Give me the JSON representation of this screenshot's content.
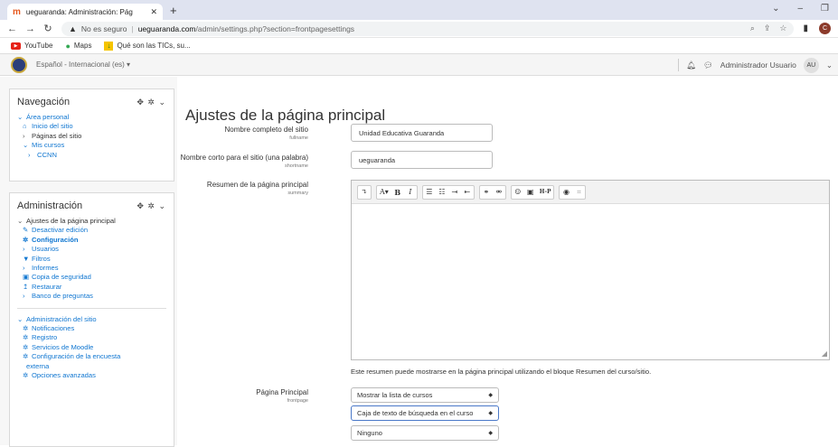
{
  "browser": {
    "tab_title": "ueguaranda: Administración: Pág",
    "url_secure_label": "No es seguro",
    "url_host": "ueguaranda.com",
    "url_path": "/admin/settings.php?section=frontpagesettings",
    "profile_initial": "C",
    "bookmarks": [
      {
        "label": "YouTube",
        "icon": "youtube-icon"
      },
      {
        "label": "Maps",
        "icon": "maps-pin-icon"
      },
      {
        "label": "Qué son las TICs, su...",
        "icon": "download-icon"
      }
    ]
  },
  "navbar": {
    "language": "Español - Internacional (es) ▾",
    "user_name": "Administrador Usuario",
    "avatar_initials": "AU"
  },
  "navigation_block": {
    "title": "Navegación",
    "items": [
      {
        "label": "Área personal",
        "prefix": "⌄",
        "style": "link",
        "indent": 1
      },
      {
        "label": "Inicio del sitio",
        "prefix": "⌂",
        "style": "link",
        "indent": 2
      },
      {
        "label": "Páginas del sitio",
        "prefix": "›",
        "style": "dark",
        "indent": 2
      },
      {
        "label": "Mis cursos",
        "prefix": "⌄",
        "style": "link",
        "indent": 2
      },
      {
        "label": "CCNN",
        "prefix": "›",
        "style": "link",
        "indent": 3
      }
    ]
  },
  "admin_block": {
    "title": "Administración",
    "section1": [
      {
        "label": "Ajustes de la página principal",
        "prefix": "⌄",
        "style": "dark",
        "indent": 1
      },
      {
        "label": "Desactivar edición",
        "prefix": "✎",
        "style": "link",
        "indent": 2
      },
      {
        "label": "Configuración",
        "prefix": "✲",
        "style": "link-bold",
        "indent": 2
      },
      {
        "label": "Usuarios",
        "prefix": "›",
        "style": "link",
        "indent": 2
      },
      {
        "label": "Filtros",
        "prefix": "▼",
        "style": "link",
        "indent": 2
      },
      {
        "label": "Informes",
        "prefix": "›",
        "style": "link",
        "indent": 2
      },
      {
        "label": "Copia de seguridad",
        "prefix": "▣",
        "style": "link",
        "indent": 2
      },
      {
        "label": "Restaurar",
        "prefix": "↥",
        "style": "link",
        "indent": 2
      },
      {
        "label": "Banco de preguntas",
        "prefix": "›",
        "style": "link",
        "indent": 2
      }
    ],
    "section2": [
      {
        "label": "Administración del sitio",
        "prefix": "⌄",
        "style": "link",
        "indent": 1
      },
      {
        "label": "Notificaciones",
        "prefix": "✲",
        "style": "link",
        "indent": 2
      },
      {
        "label": "Registro",
        "prefix": "✲",
        "style": "link",
        "indent": 2
      },
      {
        "label": "Servicios de Moodle",
        "prefix": "✲",
        "style": "link",
        "indent": 2
      },
      {
        "label": "Configuración de la encuesta",
        "prefix": "✲",
        "style": "link",
        "indent": 2
      },
      {
        "label": "externa",
        "prefix": "",
        "style": "link",
        "indent": 1
      },
      {
        "label": "Opciones avanzadas",
        "prefix": "✲",
        "style": "link",
        "indent": 2
      }
    ]
  },
  "main": {
    "page_title": "Ajustes de la página principal",
    "fullname_label": "Nombre completo del sitio",
    "fullname_key": "fullname",
    "fullname_value": "Unidad Educativa Guaranda",
    "shortname_label": "Nombre corto para el sitio (una palabra)",
    "shortname_key": "shortname",
    "shortname_value": "ueguaranda",
    "summary_label": "Resumen de la página principal",
    "summary_key": "summary",
    "summary_help": "Este resumen puede mostrarse en la página principal utilizando el bloque Resumen del curso/sitio.",
    "frontpage_label": "Página Principal",
    "frontpage_key": "frontpage",
    "frontpage_selects": [
      "Mostrar la lista de cursos",
      "Caja de texto de búsqueda en el curso",
      "Ninguno"
    ]
  }
}
